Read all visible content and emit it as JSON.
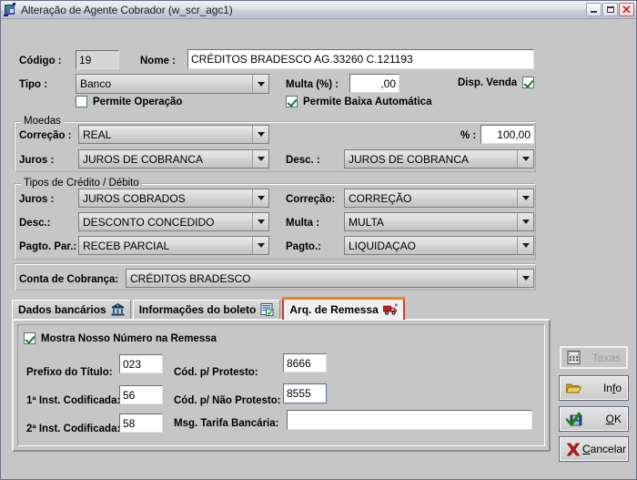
{
  "window": {
    "title": "Alteração de Agente Cobrador (w_scr_agc1)",
    "icon": "app-icon",
    "controls": {
      "minimize": "minimize-button",
      "maximize": "maximize-button",
      "close": "✕"
    }
  },
  "form": {
    "codigo": {
      "label": "Código :",
      "value": "19",
      "readonly": true
    },
    "nome": {
      "label": "Nome :",
      "value": "CRÉDITOS BRADESCO AG.33260 C.121193"
    },
    "tipo": {
      "label": "Tipo :",
      "value": "Banco"
    },
    "multa_pct": {
      "label": "Multa (%) :",
      "value": ",00"
    },
    "disp_venda": {
      "label": "Disp. Venda",
      "checked": true
    },
    "permite_operacao": {
      "label": "Permite Operação",
      "checked": false
    },
    "permite_baixa": {
      "label": "Permite Baixa Automática",
      "checked": true
    }
  },
  "moedas": {
    "group_label": "Moedas",
    "correcao": {
      "label": "Correção :",
      "value": "REAL"
    },
    "percent": {
      "label": "% :",
      "value": "100,00"
    },
    "juros": {
      "label": "Juros :",
      "value": "JUROS DE COBRANCA"
    },
    "desc": {
      "label": "Desc. :",
      "value": "JUROS DE COBRANCA"
    }
  },
  "tipos_credito_debito": {
    "group_label": "Tipos de Crédito / Débito",
    "juros": {
      "label": "Juros :",
      "value": "JUROS COBRADOS"
    },
    "correcao": {
      "label": "Correção:",
      "value": "CORREÇÃO"
    },
    "desc": {
      "label": "Desc.:",
      "value": "DESCONTO CONCEDIDO"
    },
    "multa": {
      "label": "Multa :",
      "value": "MULTA"
    },
    "pagto_par": {
      "label": "Pagto. Par.:",
      "value": "RECEB PARCIAL"
    },
    "pagto": {
      "label": "Pagto.:",
      "value": "LIQUIDAÇAO"
    }
  },
  "conta_cobranca": {
    "label": "Conta de Cobrança:",
    "value": "CRÉDITOS BRADESCO"
  },
  "tabs": [
    {
      "label": "Dados bancários",
      "icon": "bank-icon",
      "selected": false
    },
    {
      "label": "Informações do boleto",
      "icon": "document-list-icon",
      "selected": false
    },
    {
      "label": "Arq. de Remessa",
      "icon": "truck-icon",
      "selected": true
    }
  ],
  "tab_content": {
    "mostra_nosso_numero": {
      "label": "Mostra Nosso Número na Remessa",
      "checked": true
    },
    "prefixo_titulo": {
      "label": "Prefixo do Título:",
      "value": "023"
    },
    "cod_protesto": {
      "label": "Cód. p/ Protesto:",
      "value": "8666"
    },
    "inst1": {
      "label": "1ª Inst. Codificada:",
      "value": "56"
    },
    "cod_nao_protesto": {
      "label": "Cód. p/ Não  Protesto:",
      "value": "8555",
      "focused": true
    },
    "inst2": {
      "label": "2ª Inst. Codificada:",
      "value": "58"
    },
    "msg_tarifa": {
      "label": "Msg. Tarifa Bancária:",
      "value": ""
    }
  },
  "buttons": [
    {
      "label": "Taxas",
      "icon": "calculator-icon",
      "disabled": true,
      "accesskey": ""
    },
    {
      "label": "Info",
      "icon": "folder-icon",
      "disabled": false,
      "accesskey": "f"
    },
    {
      "label": "OK",
      "icon": "save-check-icon",
      "disabled": false,
      "accesskey": "O"
    },
    {
      "label": "Cancelar",
      "icon": "red-x-icon",
      "disabled": false,
      "accesskey": "C"
    }
  ],
  "colors": {
    "window_bg": "#c6c6c6",
    "selected_tab_border": "#cf3b22",
    "selected_tab_top": "#f08020",
    "check_green": "#1a7a1a",
    "cancel_red": "#c01b1b"
  }
}
